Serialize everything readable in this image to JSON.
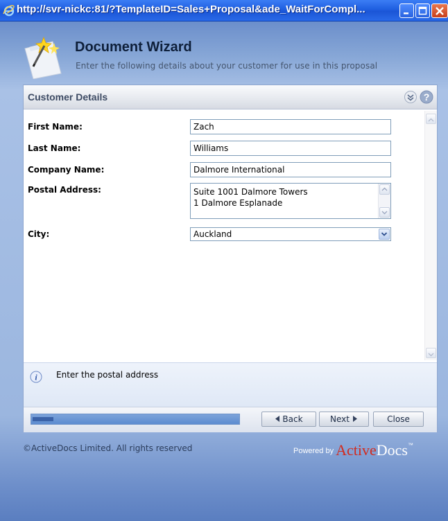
{
  "window": {
    "title": "http://svr-nickc:81/?TemplateID=Sales+Proposal&ade_WaitForCompl..."
  },
  "header": {
    "title": "Document Wizard",
    "subtitle": "Enter the following details about your customer for use in this proposal"
  },
  "panel": {
    "title": "Customer Details"
  },
  "form": {
    "first_name": {
      "label": "First Name:",
      "value": "Zach"
    },
    "last_name": {
      "label": "Last Name:",
      "value": "Williams"
    },
    "company_name": {
      "label": "Company Name:",
      "value": "Dalmore International"
    },
    "postal_address": {
      "label": "Postal Address:",
      "line1": "Suite 1001 Dalmore Towers",
      "line2": "1 Dalmore Esplanade"
    },
    "city": {
      "label": "City:",
      "selected": "Auckland"
    }
  },
  "help": {
    "text": "Enter the postal address"
  },
  "progress": {
    "fraction": 0.1
  },
  "buttons": {
    "back": "Back",
    "next": "Next",
    "close": "Close"
  },
  "footer": {
    "copyright": "©ActiveDocs Limited. All rights reserved",
    "powered_by": "Powered by",
    "brand_red": "Active",
    "brand_white": "Docs",
    "trademark": "™"
  },
  "colors": {
    "brand_red": "#d22b1e",
    "titlebar_blue": "#1f5fe0",
    "panel_border": "#8fa7cf"
  }
}
